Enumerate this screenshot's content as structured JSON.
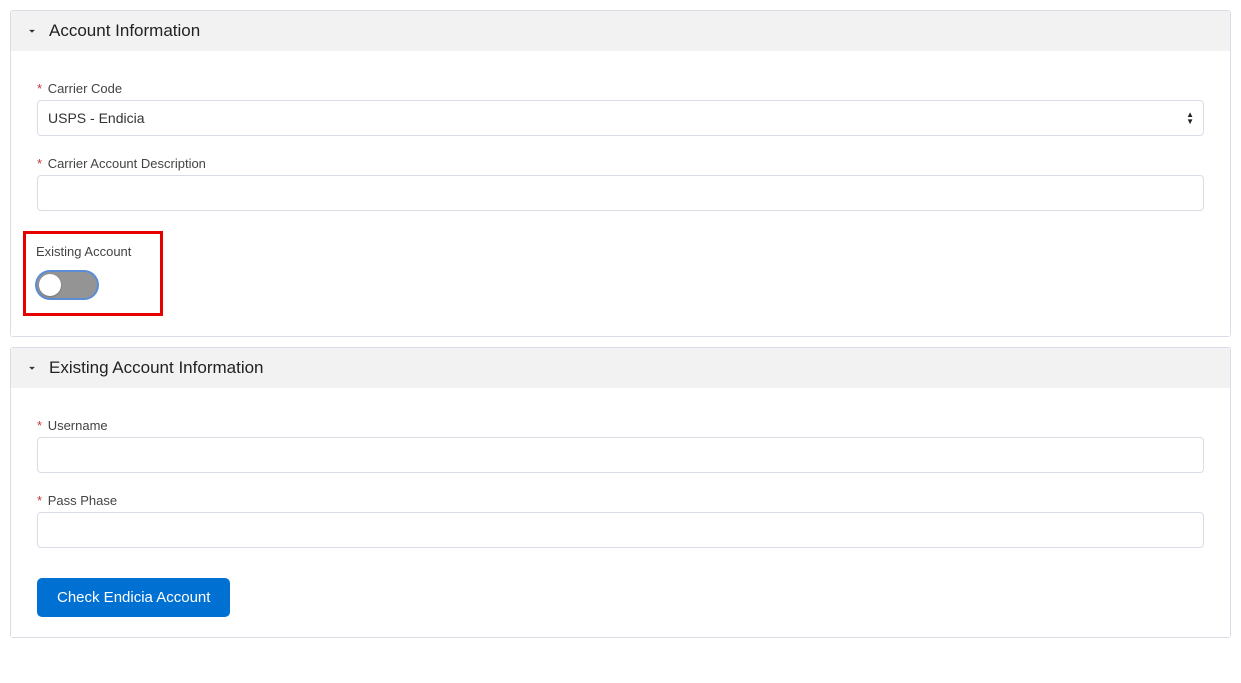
{
  "sections": {
    "account_info": {
      "title": "Account Information",
      "fields": {
        "carrier_code": {
          "label": "Carrier Code",
          "value": "USPS - Endicia",
          "required": true
        },
        "carrier_desc": {
          "label": "Carrier Account Description",
          "value": "",
          "required": true
        },
        "existing_account": {
          "label": "Existing Account",
          "value": false
        }
      }
    },
    "existing_info": {
      "title": "Existing Account Information",
      "fields": {
        "username": {
          "label": "Username",
          "value": "",
          "required": true
        },
        "passphase": {
          "label": "Pass Phase",
          "value": "",
          "required": true
        }
      },
      "button": {
        "label": "Check Endicia Account"
      }
    }
  }
}
